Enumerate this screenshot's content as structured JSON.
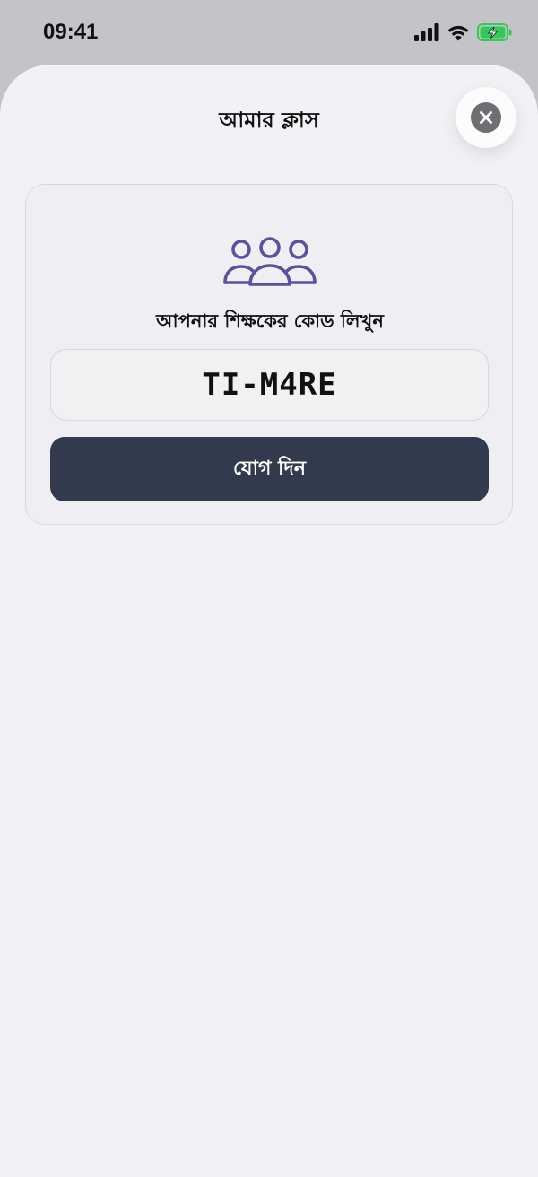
{
  "status_bar": {
    "time": "09:41",
    "icons": [
      "cellular-signal-icon",
      "wifi-icon",
      "battery-charging-icon"
    ]
  },
  "sheet": {
    "title": "আমার ক্লাস",
    "close_icon": "close-icon"
  },
  "join_card": {
    "icon": "group-users-icon",
    "prompt": "আপনার শিক্ষকের কোড লিখুন",
    "code_value": "TI-M4RE",
    "join_button_label": "যোগ দিন"
  },
  "colors": {
    "accent_icon": "#5b5397",
    "button_bg": "#323a4e",
    "battery_green": "#34c759",
    "sheet_bg": "#f2f2f6"
  }
}
